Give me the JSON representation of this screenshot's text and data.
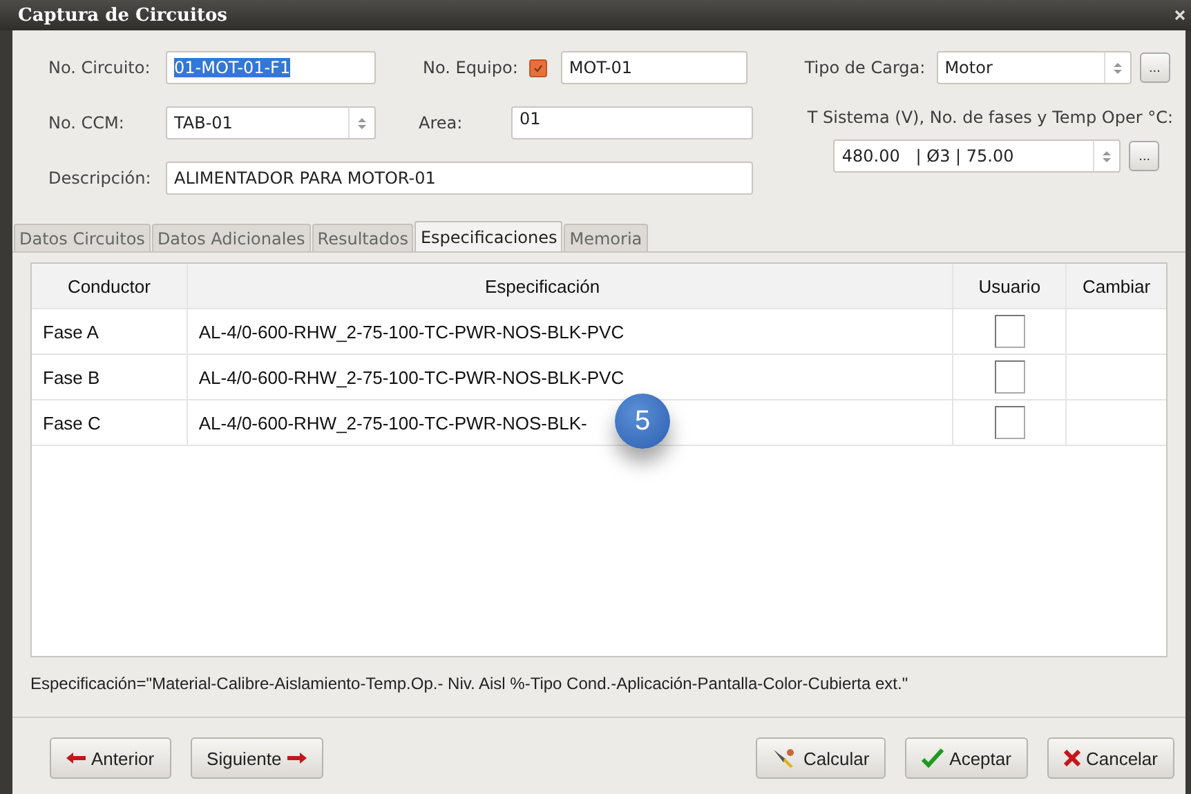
{
  "window": {
    "title": "Captura de Circuitos"
  },
  "form": {
    "circuito": {
      "label": "No. Circuito:",
      "value": "01-MOT-01-F1"
    },
    "equipo": {
      "label": "No. Equipo:",
      "checked": true,
      "value": "MOT-01"
    },
    "tipo_carga": {
      "label": "Tipo de Carga:",
      "value": "Motor"
    },
    "ccm": {
      "label": "No. CCM:",
      "value": "TAB-01"
    },
    "area": {
      "label": "Area:",
      "value": "01"
    },
    "sistema": {
      "label": "T Sistema (V), No. de fases y Temp Oper °C:",
      "value": "480.00   | Ø3 | 75.00"
    },
    "descripcion": {
      "label": "Descripción:",
      "value": "ALIMENTADOR PARA MOTOR-01"
    },
    "more_button": "..."
  },
  "tabs": [
    {
      "label": "Datos Circuitos",
      "selected": false
    },
    {
      "label": "Datos Adicionales",
      "selected": false
    },
    {
      "label": "Resultados",
      "selected": false
    },
    {
      "label": "Especificaciones",
      "selected": true
    },
    {
      "label": "Memoria",
      "selected": false
    }
  ],
  "table": {
    "columns": [
      "Conductor",
      "Especificación",
      "Usuario",
      "Cambiar"
    ],
    "rows": [
      {
        "conductor": "Fase A",
        "especificacion": "AL-4/0-600-RHW_2-75-100-TC-PWR-NOS-BLK-PVC",
        "usuario": false
      },
      {
        "conductor": "Fase B",
        "especificacion": "AL-4/0-600-RHW_2-75-100-TC-PWR-NOS-BLK-PVC",
        "usuario": false
      },
      {
        "conductor": "Fase C",
        "especificacion": "AL-4/0-600-RHW_2-75-100-TC-PWR-NOS-BLK-",
        "usuario": false
      }
    ]
  },
  "callout": "5",
  "note": "Especificación=\"Material-Calibre-Aislamiento-Temp.Op.- Niv. Aisl %-Tipo Cond.-Aplicación-Pantalla-Color-Cubierta ext.\"",
  "buttons_left": [
    {
      "label": "Anterior",
      "kind": "prev"
    },
    {
      "label": "Siguiente",
      "kind": "next"
    }
  ],
  "buttons_right": [
    {
      "label": "Calcular",
      "kind": "calc"
    },
    {
      "label": "Aceptar",
      "kind": "ok"
    },
    {
      "label": "Cancelar",
      "kind": "cancel"
    }
  ]
}
